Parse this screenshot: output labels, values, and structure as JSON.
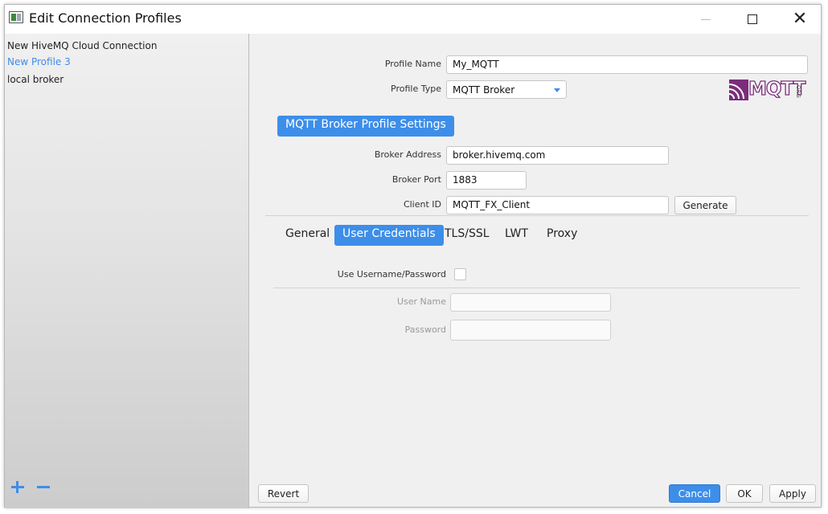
{
  "window": {
    "title": "Edit Connection Profiles"
  },
  "sidebar": {
    "profiles": [
      {
        "label": "New HiveMQ Cloud Connection"
      },
      {
        "label": "New Profile 3"
      },
      {
        "label": "local broker"
      }
    ],
    "selected_index": 1
  },
  "form": {
    "profile_name_label": "Profile Name",
    "profile_name_value": "My_MQTT",
    "profile_type_label": "Profile Type",
    "profile_type_value": "MQTT Broker",
    "logo_text": "MQTT",
    "logo_sub": "ORG",
    "section_title": "MQTT Broker Profile Settings",
    "broker_address_label": "Broker Address",
    "broker_address_value": "broker.hivemq.com",
    "broker_port_label": "Broker Port",
    "broker_port_value": "1883",
    "client_id_label": "Client ID",
    "client_id_value": "MQTT_FX_Client",
    "generate_label": "Generate"
  },
  "tabs": [
    {
      "label": "General"
    },
    {
      "label": "User Credentials"
    },
    {
      "label": "TLS/SSL"
    },
    {
      "label": "LWT"
    },
    {
      "label": "Proxy"
    }
  ],
  "active_tab": "User Credentials",
  "credentials": {
    "use_username_label": "Use Username/Password",
    "use_username_checked": false,
    "username_label": "User Name",
    "username_value": "",
    "password_label": "Password",
    "password_value": ""
  },
  "footer": {
    "revert_label": "Revert",
    "cancel_label": "Cancel",
    "ok_label": "OK",
    "apply_label": "Apply"
  },
  "colors": {
    "accent": "#3d8ee9",
    "logo": "#7a2d7a"
  }
}
